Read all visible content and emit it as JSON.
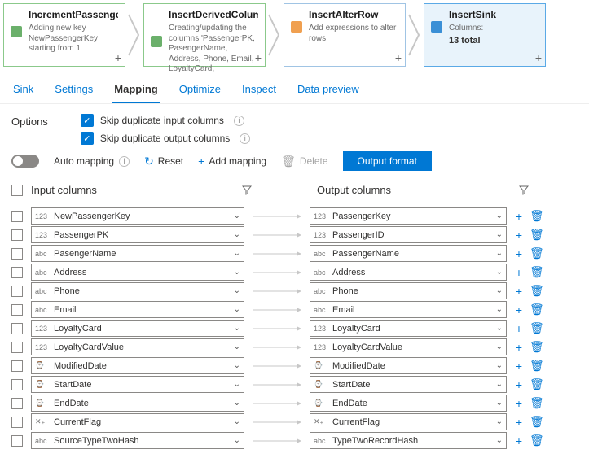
{
  "flow": [
    {
      "title": "IncrementPassengerKey",
      "desc": "Adding new key NewPassengerKey starting from 1",
      "style": "green"
    },
    {
      "title": "InsertDerivedColumn",
      "desc": "Creating/updating the columns 'PassengerPK, PasengerName, Address, Phone, Email, LoyaltyCard,",
      "style": "green"
    },
    {
      "title": "InsertAlterRow",
      "desc": "Add expressions to alter rows",
      "style": "blue"
    },
    {
      "title": "InsertSink",
      "desc": "Columns:",
      "extra": "13 total",
      "style": "selected"
    }
  ],
  "tabs": [
    "Sink",
    "Settings",
    "Mapping",
    "Optimize",
    "Inspect",
    "Data preview"
  ],
  "activeTab": "Mapping",
  "options": {
    "label": "Options",
    "skipIn": "Skip duplicate input columns",
    "skipOut": "Skip duplicate output columns"
  },
  "toolbar": {
    "autoMap": "Auto mapping",
    "reset": "Reset",
    "addMapping": "Add mapping",
    "delete": "Delete",
    "outputFormat": "Output format"
  },
  "headers": {
    "input": "Input columns",
    "output": "Output columns"
  },
  "typeIcons": {
    "num": "123",
    "str": "abc",
    "date": "⌚",
    "flag": "✕₊"
  },
  "rows": [
    {
      "inType": "num",
      "in": "NewPassengerKey",
      "outType": "num",
      "out": "PassengerKey"
    },
    {
      "inType": "num",
      "in": "PassengerPK",
      "outType": "num",
      "out": "PassengerID"
    },
    {
      "inType": "str",
      "in": "PasengerName",
      "outType": "str",
      "out": "PassengerName"
    },
    {
      "inType": "str",
      "in": "Address",
      "outType": "str",
      "out": "Address"
    },
    {
      "inType": "str",
      "in": "Phone",
      "outType": "str",
      "out": "Phone"
    },
    {
      "inType": "str",
      "in": "Email",
      "outType": "str",
      "out": "Email"
    },
    {
      "inType": "num",
      "in": "LoyaltyCard",
      "outType": "num",
      "out": "LoyaltyCard"
    },
    {
      "inType": "num",
      "in": "LoyaltyCardValue",
      "outType": "num",
      "out": "LoyaltyCardValue"
    },
    {
      "inType": "date",
      "in": "ModifiedDate",
      "outType": "date",
      "out": "ModifiedDate"
    },
    {
      "inType": "date",
      "in": "StartDate",
      "outType": "date",
      "out": "StartDate"
    },
    {
      "inType": "date",
      "in": "EndDate",
      "outType": "date",
      "out": "EndDate"
    },
    {
      "inType": "flag",
      "in": "CurrentFlag",
      "outType": "flag",
      "out": "CurrentFlag"
    },
    {
      "inType": "str",
      "in": "SourceTypeTwoHash",
      "outType": "str",
      "out": "TypeTwoRecordHash"
    }
  ]
}
